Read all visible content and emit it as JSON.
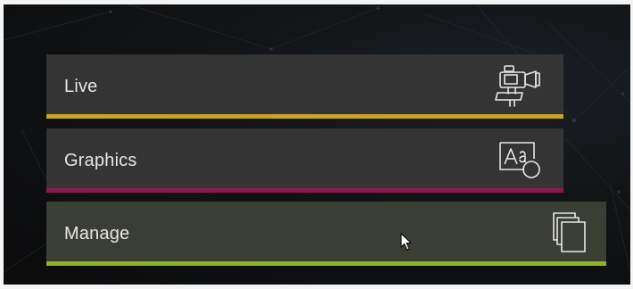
{
  "menu": {
    "items": [
      {
        "id": "live",
        "label": "Live",
        "icon": "video-camera-icon",
        "accent_color": "#c9a227"
      },
      {
        "id": "graphics",
        "label": "Graphics",
        "icon": "text-shape-icon",
        "accent_color": "#8a1a4d"
      },
      {
        "id": "manage",
        "label": "Manage",
        "icon": "stacked-pages-icon",
        "accent_color": "#8fb31f"
      }
    ]
  },
  "colors": {
    "background": "#0b0b0c",
    "tile": "#343434",
    "tile_hover": "#3b3e33",
    "text": "#e6e6e6",
    "icon": "#e8e8e8"
  },
  "pointer": "mouse-pointer-icon"
}
